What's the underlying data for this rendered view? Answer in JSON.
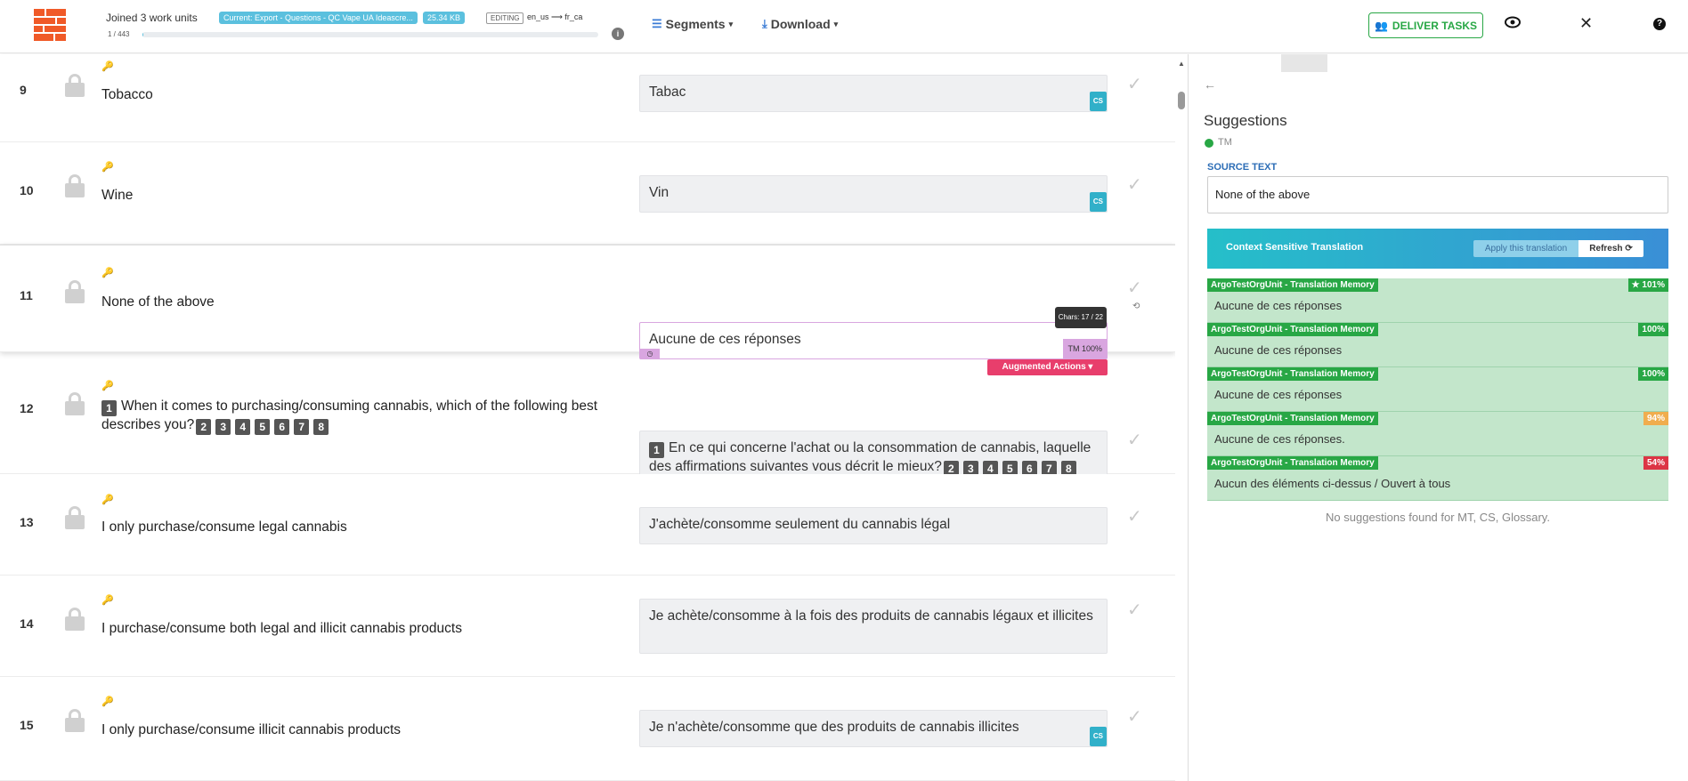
{
  "header": {
    "joined": "Joined 3 work units",
    "current_badge": "Current: Export - Questions - QC Vape UA Ideascre...",
    "size_badge": "25.34 KB",
    "editing": "EDITING",
    "lang_pair": "en_us ⟶ fr_ca",
    "progress_text": "1 / 443",
    "progress_fraction": 0.0023,
    "segments_label": "Segments",
    "download_label": "Download",
    "deliver_label": "DELIVER TASKS"
  },
  "segments": [
    {
      "num": "9",
      "source": "Tobacco",
      "target": "Tabac",
      "cs": "CS"
    },
    {
      "num": "10",
      "source": "Wine",
      "target": "Vin",
      "cs": "CS"
    },
    {
      "num": "11",
      "source": "None of the above",
      "target": "Aucune de ces réponses",
      "chars": "Chars: 17 / 22",
      "tm": "TM 100%",
      "augmented": "Augmented Actions",
      "history": "1"
    },
    {
      "num": "12",
      "source_text": "When it comes to purchasing/consuming cannabis, which of the following best describes you?",
      "source_tags": [
        "1",
        "2",
        "3",
        "4",
        "5",
        "6",
        "7",
        "8"
      ],
      "target_text": "En ce qui concerne l'achat ou la consommation de cannabis, laquelle des affirmations suivantes vous décrit le mieux?"
    },
    {
      "num": "13",
      "source": "I only purchase/consume legal cannabis",
      "target": "J'achète/consomme seulement du cannabis légal"
    },
    {
      "num": "14",
      "source": "I purchase/consume both legal and illicit cannabis products",
      "target": "Je achète/consomme à la fois des produits de cannabis légaux et illicites"
    },
    {
      "num": "15",
      "source": "I only purchase/consume illicit cannabis products",
      "target": "Je n'achète/consomme que des produits de cannabis illicites",
      "cs": "CS"
    }
  ],
  "panel": {
    "title": "Suggestions",
    "tm_label": "TM",
    "source_label": "SOURCE TEXT",
    "source_text": "None of the above",
    "cst_title": "Context Sensitive Translation",
    "apply_label": "Apply this translation",
    "refresh_label": "Refresh",
    "tm_results": [
      {
        "origin": "ArgoTestOrgUnit - Translation Memory",
        "score": "101%",
        "color": "#28a745",
        "text": "Aucune de ces réponses"
      },
      {
        "origin": "ArgoTestOrgUnit - Translation Memory",
        "score": "100%",
        "color": "#28a745",
        "text": "Aucune de ces réponses"
      },
      {
        "origin": "ArgoTestOrgUnit - Translation Memory",
        "score": "100%",
        "color": "#28a745",
        "text": "Aucune de ces réponses"
      },
      {
        "origin": "ArgoTestOrgUnit - Translation Memory",
        "score": "94%",
        "color": "#f0ad4e",
        "text": "Aucune de ces réponses."
      },
      {
        "origin": "ArgoTestOrgUnit - Translation Memory",
        "score": "54%",
        "color": "#dc3545",
        "text": "Aucun des éléments ci-dessus / Ouvert à tous"
      }
    ],
    "no_suggestions": "No suggestions found for MT, CS, Glossary."
  }
}
